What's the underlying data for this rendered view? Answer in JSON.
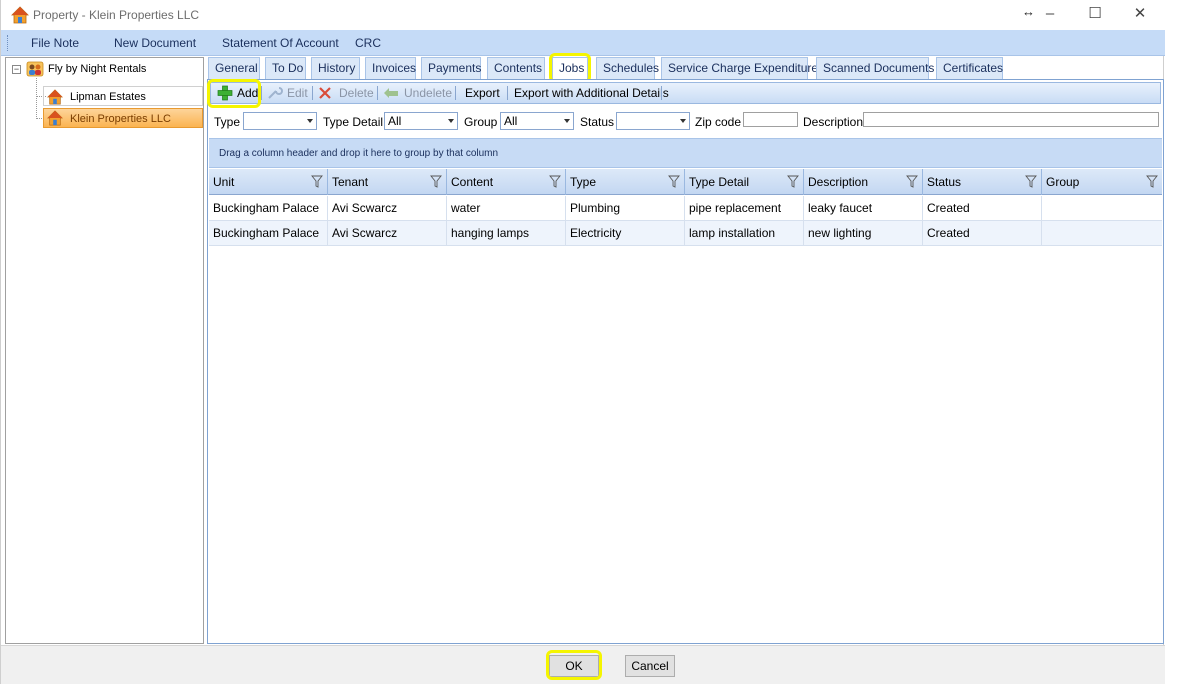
{
  "window": {
    "title": "Property - Klein Properties LLC",
    "resize_glyph": "↔",
    "minimize": "–",
    "maximize": "☐",
    "close": "✕"
  },
  "menu": {
    "items": [
      "File Note",
      "New Document",
      "Statement Of Account",
      "CRC"
    ]
  },
  "tree": {
    "root": {
      "label": "Fly by Night Rentals",
      "expander": "−",
      "icon": "people-icon"
    },
    "children": [
      {
        "label": "Lipman Estates",
        "icon": "house-icon"
      },
      {
        "label": "Klein Properties LLC",
        "icon": "house-icon",
        "selected": true
      }
    ]
  },
  "tabs": [
    "General",
    "To Do",
    "History",
    "Invoices",
    "Payments",
    "Contents",
    "Jobs",
    "Schedules",
    "Service Charge Expenditure",
    "Scanned Documents",
    "Certificates"
  ],
  "active_tab": "Jobs",
  "toolbar": {
    "add": "Add",
    "edit": "Edit",
    "delete": "Delete",
    "undelete": "Undelete",
    "export": "Export",
    "export_details": "Export with Additional Details"
  },
  "filters": {
    "type_label": "Type",
    "type_value": "",
    "type_detail_label": "Type Detail",
    "type_detail_value": "All",
    "group_label": "Group",
    "group_value": "All",
    "status_label": "Status",
    "status_value": "",
    "zip_label": "Zip code",
    "zip_value": "",
    "description_label": "Description",
    "description_value": ""
  },
  "group_panel": {
    "text": "Drag a column header and drop it here to group by that column"
  },
  "grid": {
    "columns": [
      "Unit",
      "Tenant",
      "Content",
      "Type",
      "Type Detail",
      "Description",
      "Status",
      "Group"
    ],
    "rows": [
      [
        "Buckingham Palace",
        "Avi Scwarcz",
        "water",
        "Plumbing",
        "pipe replacement",
        "leaky faucet",
        "Created",
        ""
      ],
      [
        "Buckingham Palace",
        "Avi Scwarcz",
        "hanging lamps",
        "Electricity",
        "lamp installation",
        "new lighting",
        "Created",
        ""
      ]
    ]
  },
  "dialog": {
    "ok": "OK",
    "cancel": "Cancel"
  },
  "colors": {
    "highlight": "#f5f500",
    "selected_node": "#fbb451",
    "menu_bg": "#c5dbf7"
  }
}
